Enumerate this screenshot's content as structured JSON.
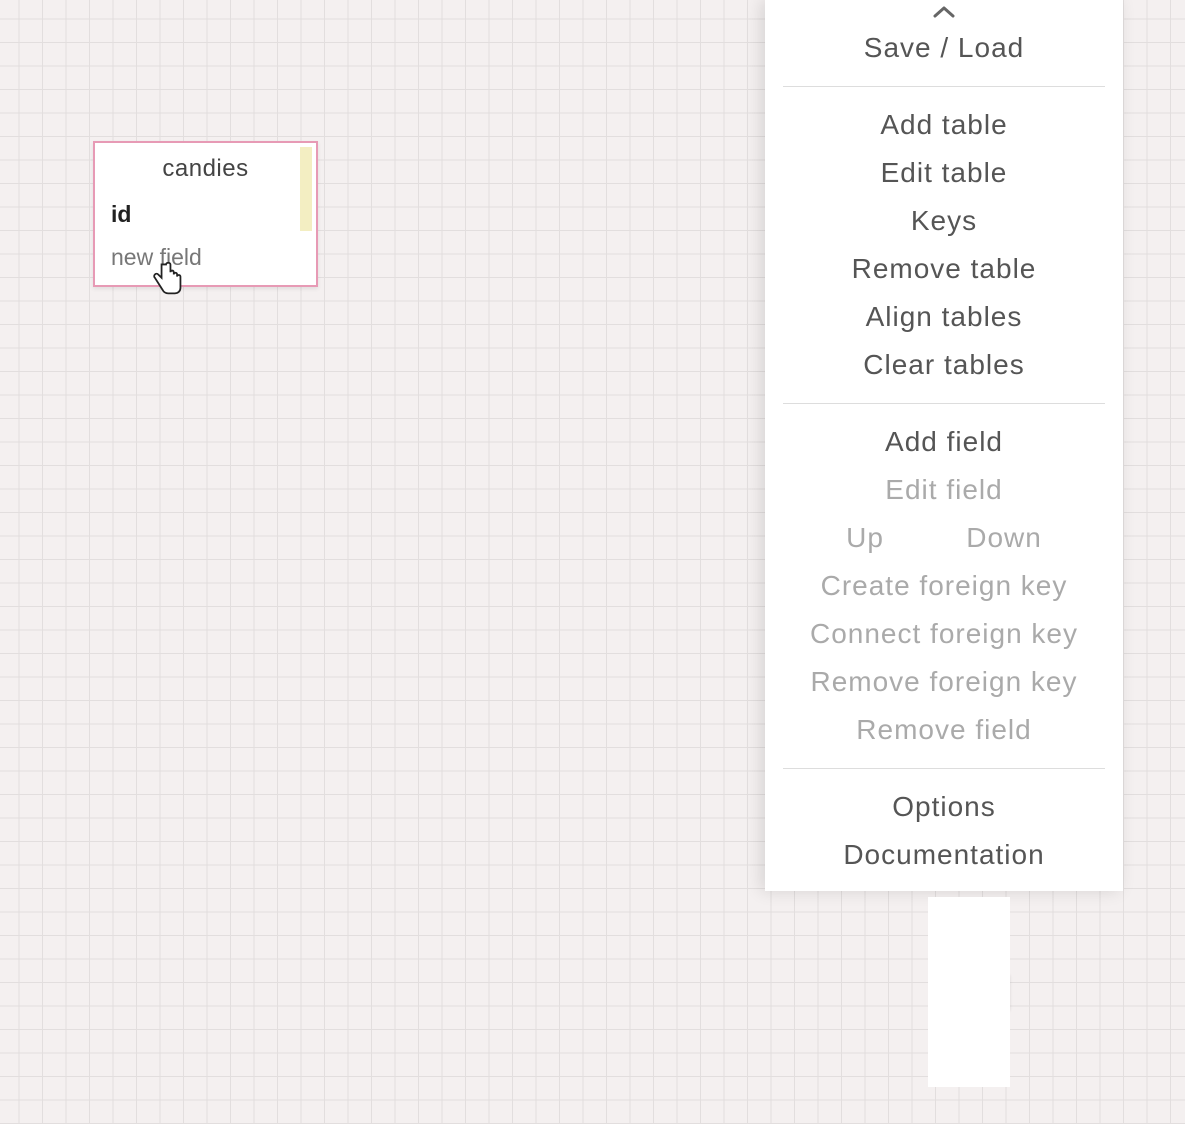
{
  "table": {
    "name": "candies",
    "fields": [
      {
        "label": "id",
        "bold": true
      },
      {
        "label": "new field",
        "bold": false
      }
    ]
  },
  "sidebar": {
    "saveLoad": "Save / Load",
    "group1": {
      "addTable": "Add table",
      "editTable": "Edit table",
      "keys": "Keys",
      "removeTable": "Remove table",
      "alignTables": "Align tables",
      "clearTables": "Clear tables"
    },
    "group2": {
      "addField": "Add field",
      "editField": "Edit field",
      "up": "Up",
      "down": "Down",
      "createFK": "Create foreign key",
      "connectFK": "Connect foreign key",
      "removeFK": "Remove foreign key",
      "removeField": "Remove field"
    },
    "group3": {
      "options": "Options",
      "documentation": "Documentation"
    }
  },
  "colors": {
    "tableBorder": "#e79ab5",
    "highlight": "#f3eec2"
  }
}
